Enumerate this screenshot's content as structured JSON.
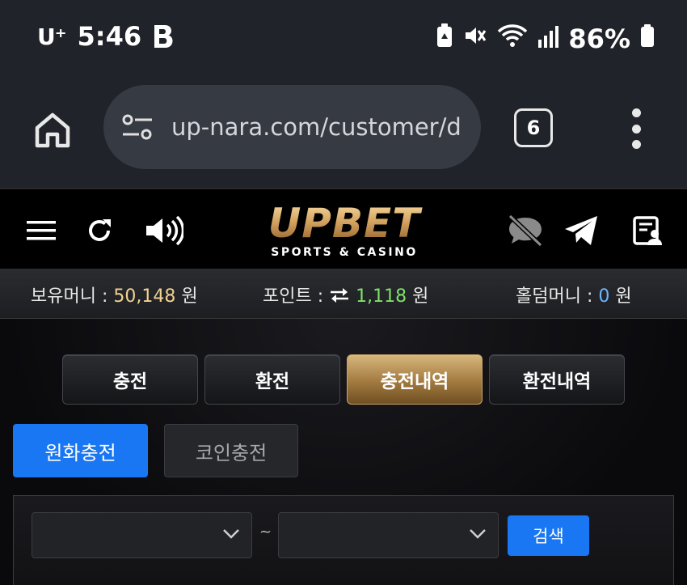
{
  "status_bar": {
    "carrier": "U⁺",
    "time": "5:46",
    "battery_level": "86%"
  },
  "browser": {
    "url": "up-nara.com/customer/d",
    "tab_count": "6"
  },
  "site_header": {
    "logo_main": "UPBET",
    "logo_sub": "SPORTS & CASINO"
  },
  "balance": {
    "money_label": "보유머니 :",
    "money_value": "50,148",
    "money_unit": "원",
    "point_label": "포인트 :",
    "point_value": "1,118",
    "point_unit": "원",
    "holdem_label": "홀덤머니 :",
    "holdem_value": "0",
    "holdem_unit": "원"
  },
  "main_tabs": [
    {
      "label": "충전",
      "active": false
    },
    {
      "label": "환전",
      "active": false
    },
    {
      "label": "충전내역",
      "active": true
    },
    {
      "label": "환전내역",
      "active": false
    }
  ],
  "sub_tabs": [
    {
      "label": "원화충전",
      "active": true
    },
    {
      "label": "코인충전",
      "active": false
    }
  ],
  "search": {
    "start_value": "",
    "end_value": "",
    "separator": "~",
    "button_label": "검색"
  },
  "colors": {
    "accent_blue": "#1977f3",
    "gold": "#d6a462",
    "green_value": "#7fe06a"
  }
}
